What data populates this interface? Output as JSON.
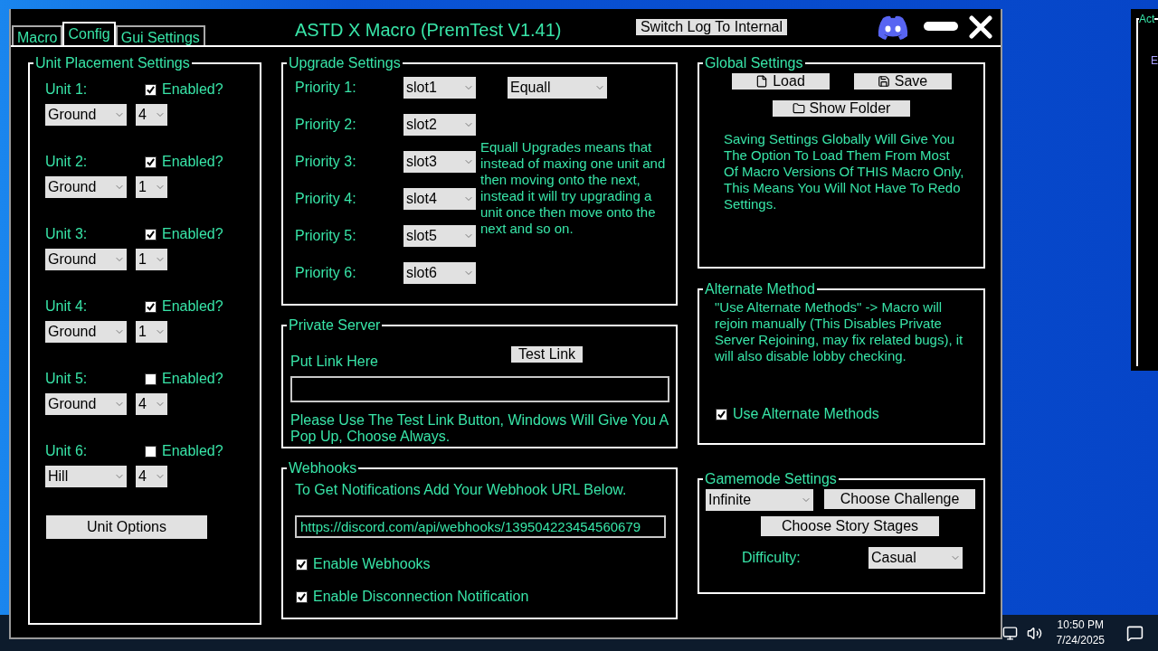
{
  "window": {
    "title": "ASTD X Macro (PremTest V1.41)"
  },
  "tabs": [
    {
      "label": "Macro",
      "selected": false
    },
    {
      "label": "Config",
      "selected": true
    },
    {
      "label": "Gui Settings",
      "selected": false
    }
  ],
  "log_button": "Switch Log To Internal",
  "unit_placement": {
    "title": "Unit Placement Settings",
    "units": [
      {
        "label": "Unit 1:",
        "enabled_label": "Enabled?",
        "enabled": true,
        "placement": "Ground",
        "slot": "4"
      },
      {
        "label": "Unit 2:",
        "enabled_label": "Enabled?",
        "enabled": true,
        "placement": "Ground",
        "slot": "1"
      },
      {
        "label": "Unit 3:",
        "enabled_label": "Enabled?",
        "enabled": true,
        "placement": "Ground",
        "slot": "1"
      },
      {
        "label": "Unit 4:",
        "enabled_label": "Enabled?",
        "enabled": true,
        "placement": "Ground",
        "slot": "1"
      },
      {
        "label": "Unit 5:",
        "enabled_label": "Enabled?",
        "enabled": false,
        "placement": "Ground",
        "slot": "4"
      },
      {
        "label": "Unit 6:",
        "enabled_label": "Enabled?",
        "enabled": false,
        "placement": "Hill",
        "slot": "4"
      }
    ],
    "options_button": "Unit Options"
  },
  "upgrade_settings": {
    "title": "Upgrade Settings",
    "priorities": [
      {
        "label": "Priority 1:",
        "value": "slot1"
      },
      {
        "label": "Priority 2:",
        "value": "slot2"
      },
      {
        "label": "Priority 3:",
        "value": "slot3"
      },
      {
        "label": "Priority 4:",
        "value": "slot4"
      },
      {
        "label": "Priority 5:",
        "value": "slot5"
      },
      {
        "label": "Priority 6:",
        "value": "slot6"
      }
    ],
    "mode": "Equall",
    "note": "Equall Upgrades means that instead of maxing one unit and then moving onto the next, instead it will try upgrading a unit once then move onto the next and so on."
  },
  "private_server": {
    "title": "Private Server",
    "prompt": "Put Link Here",
    "test_button": "Test Link",
    "note": "Please Use The Test Link Button, Windows Will Give You A Pop Up, Choose Always."
  },
  "webhooks": {
    "title": "Webhooks",
    "prompt": "To Get Notifications Add Your Webhook URL Below.",
    "url": "https://discord.com/api/webhooks/139504223454560679",
    "options": [
      {
        "label": "Enable Webhooks",
        "checked": true
      },
      {
        "label": "Enable Disconnection Notification",
        "checked": true
      }
    ]
  },
  "global_settings": {
    "title": "Global Settings",
    "load_button": "Load",
    "save_button": "Save",
    "folder_button": "Show Folder",
    "note": "Saving Settings Globally Will Give You The Option To Load Them From Most Of Macro Versions Of THIS Macro Only, This Means You Will Not Have To Redo Settings."
  },
  "alternate_method": {
    "title": "Alternate Method",
    "note": "\"Use Alternate Methods\" -> Macro will rejoin manually (This Disables Private Server Rejoining, may fix related bugs), it will also disable lobby checking.",
    "option": {
      "label": "Use Alternate Methods",
      "checked": true
    }
  },
  "gamemode": {
    "title": "Gamemode Settings",
    "mode": "Infinite",
    "challenge_button": "Choose Challenge",
    "story_button": "Choose Story Stages",
    "difficulty_label": "Difficulty:",
    "difficulty": "Casual"
  },
  "background_window": {
    "title": "Act",
    "text": "E"
  },
  "taskbar": {
    "time": "10:50 PM",
    "date": "7/24/2025"
  }
}
